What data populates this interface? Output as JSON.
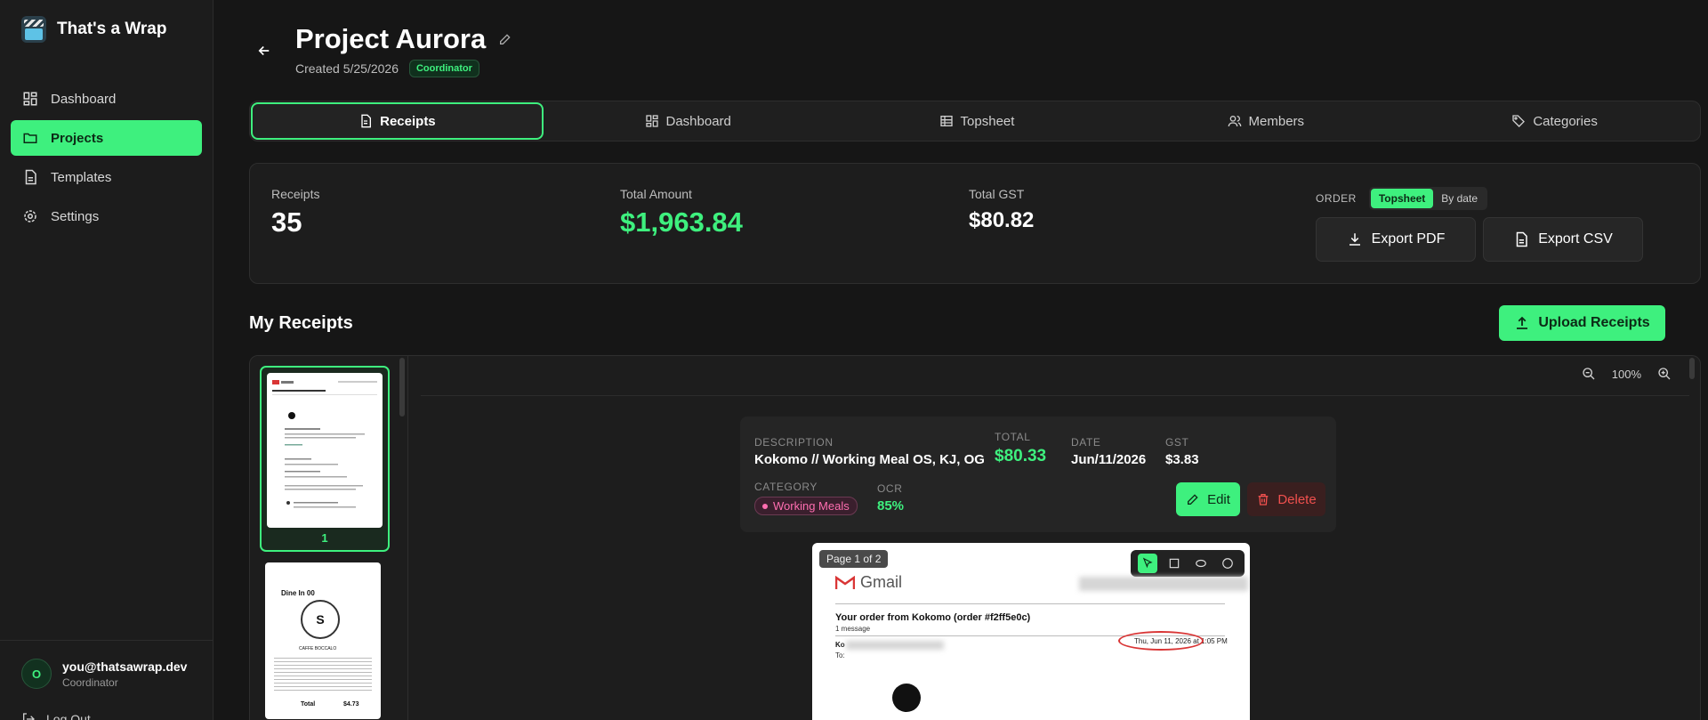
{
  "app": {
    "name": "That's a Wrap"
  },
  "sidebar": {
    "items": [
      {
        "label": "Dashboard",
        "icon": "dashboard-icon",
        "active": false
      },
      {
        "label": "Projects",
        "icon": "folder-icon",
        "active": true
      },
      {
        "label": "Templates",
        "icon": "document-icon",
        "active": false
      },
      {
        "label": "Settings",
        "icon": "gear-icon",
        "active": false
      }
    ],
    "user": {
      "initial": "O",
      "email": "you@thatsawrap.dev",
      "role": "Coordinator"
    },
    "logout": "Log Out"
  },
  "project": {
    "title": "Project Aurora",
    "created": "Created 5/25/2026",
    "role_badge": "Coordinator"
  },
  "tabs": [
    {
      "label": "Receipts",
      "icon": "receipt-icon",
      "active": true
    },
    {
      "label": "Dashboard",
      "icon": "dashboard-icon",
      "active": false
    },
    {
      "label": "Topsheet",
      "icon": "table-icon",
      "active": false
    },
    {
      "label": "Members",
      "icon": "users-icon",
      "active": false
    },
    {
      "label": "Categories",
      "icon": "tag-icon",
      "active": false
    }
  ],
  "stats": {
    "receipts_label": "Receipts",
    "receipts_value": "35",
    "total_label": "Total Amount",
    "total_value": "$1,963.84",
    "gst_label": "Total GST",
    "gst_value": "$80.82",
    "order_label": "ORDER",
    "order_options": [
      "Topsheet",
      "By date"
    ],
    "order_selected": "Topsheet",
    "export_pdf": "Export PDF",
    "export_csv": "Export CSV"
  },
  "receipts": {
    "section_title": "My Receipts",
    "upload_label": "Upload Receipts",
    "thumb_numbers": [
      "1"
    ],
    "zoom": "100%"
  },
  "selected": {
    "description_label": "DESCRIPTION",
    "description": "Kokomo // Working Meal OS, KJ, OG",
    "total_label": "TOTAL",
    "total": "$80.33",
    "date_label": "DATE",
    "date": "Jun/11/2026",
    "gst_label": "GST",
    "gst": "$3.83",
    "category_label": "CATEGORY",
    "category": "Working Meals",
    "ocr_label": "OCR",
    "ocr": "85%",
    "edit_label": "Edit",
    "delete_label": "Delete"
  },
  "document": {
    "page_tag": "Page 1 of 2",
    "gmail": "Gmail",
    "subject": "Your order from Kokomo (order #f2ff5e0c)",
    "messages": "1 message",
    "from": "Ko",
    "to": "To:",
    "date": "Thu, Jun 11, 2026 at 1:05 PM"
  },
  "thumb2": {
    "dine_in": "Dine In 00",
    "shop": "CAFFE BOCCALO",
    "total": "Total",
    "total_value": "$4.73"
  },
  "colors": {
    "accent": "#3ef07e",
    "danger": "#f0504e",
    "category": "#ff6eb0"
  }
}
